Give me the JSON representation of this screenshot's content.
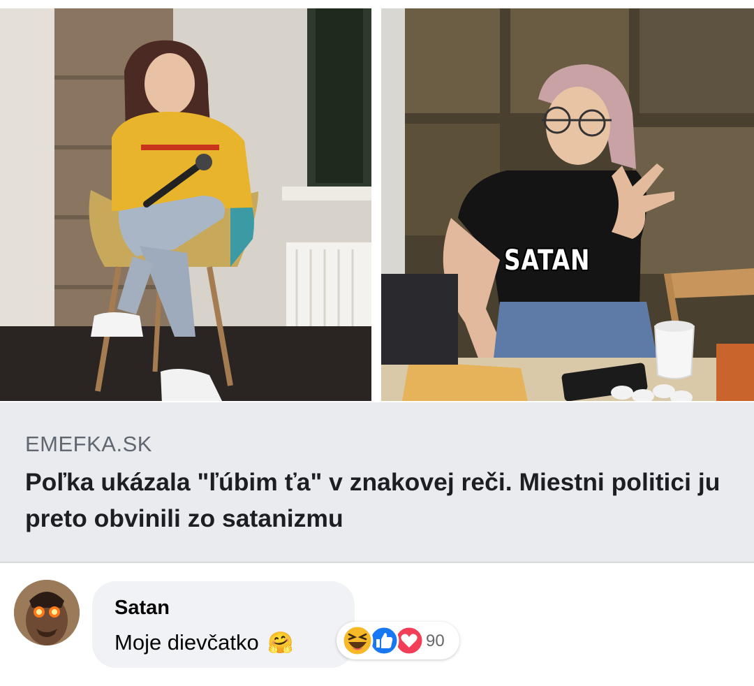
{
  "photos": {
    "left": {
      "subject": "woman-with-microphone"
    },
    "right": {
      "subject": "woman-sign-gesture",
      "caption": "SATAN"
    }
  },
  "link_preview": {
    "domain": "EMEFKA.SK",
    "title": "Poľka ukázala \"ľúbim ťa\" v znakovej reči. Miestni politici ju preto obvinili zo satanizmu"
  },
  "comment": {
    "author": "Satan",
    "text": "Moje dievčatko",
    "emoji": "🤗",
    "reactions": {
      "icons": [
        "haha-icon",
        "like-icon",
        "love-icon"
      ],
      "count": "90"
    }
  },
  "colors": {
    "preview_bg": "#eaebef",
    "bubble_bg": "#f0f2f5",
    "like": "#1877f2",
    "love": "#f33e58",
    "haha": "#f7b928",
    "muted_text": "#606770"
  }
}
